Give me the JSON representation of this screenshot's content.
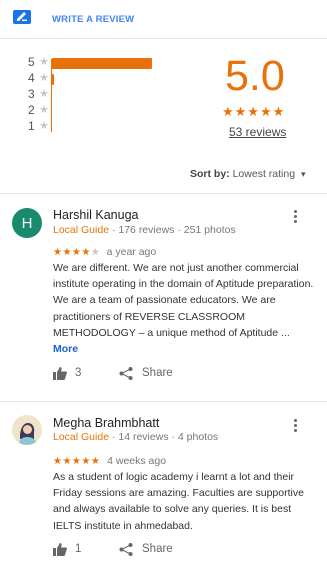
{
  "header": {
    "write_review_label": "WRITE A REVIEW"
  },
  "histogram": [
    {
      "stars": "5",
      "fraction": 1.0
    },
    {
      "stars": "4",
      "fraction": 0.02
    },
    {
      "stars": "3",
      "fraction": 0.0
    },
    {
      "stars": "2",
      "fraction": 0.0
    },
    {
      "stars": "1",
      "fraction": 0.0
    }
  ],
  "summary": {
    "rating": "5.0",
    "stars": "★★★★★",
    "reviews_link": "53 reviews"
  },
  "sort": {
    "label": "Sort by:",
    "value": "Lowest rating"
  },
  "reviews": [
    {
      "avatar_letter": "H",
      "name": "Harshil Kanuga",
      "guide": "Local Guide",
      "stats": " · 176 reviews · 251 photos",
      "stars_filled": "★★★★",
      "stars_empty": "★",
      "ago": "a year ago",
      "text": " We are different. We are not just another commercial institute operating in the domain of Aptitude preparation. We are a team of passionate educators. We are practitioners of REVERSE CLASSROOM METHODOLOGY – a unique method of Aptitude ...",
      "more": "More",
      "likes": "3",
      "share": "Share"
    },
    {
      "avatar_letter": "",
      "name": "Megha Brahmbhatt",
      "guide": "Local Guide",
      "stats": " · 14 reviews · 4 photos",
      "stars_filled": "★★★★★",
      "stars_empty": "",
      "ago": "4 weeks ago",
      "text": "As a student of logic academy i learnt a lot and their Friday sessions are amazing. Faculties are supportive and always available to solve any queries. It is best IELTS institute in ahmedabad.",
      "more": "",
      "likes": "1",
      "share": "Share"
    }
  ],
  "colors": {
    "accent": "#e8710a",
    "link": "#4285f4"
  }
}
